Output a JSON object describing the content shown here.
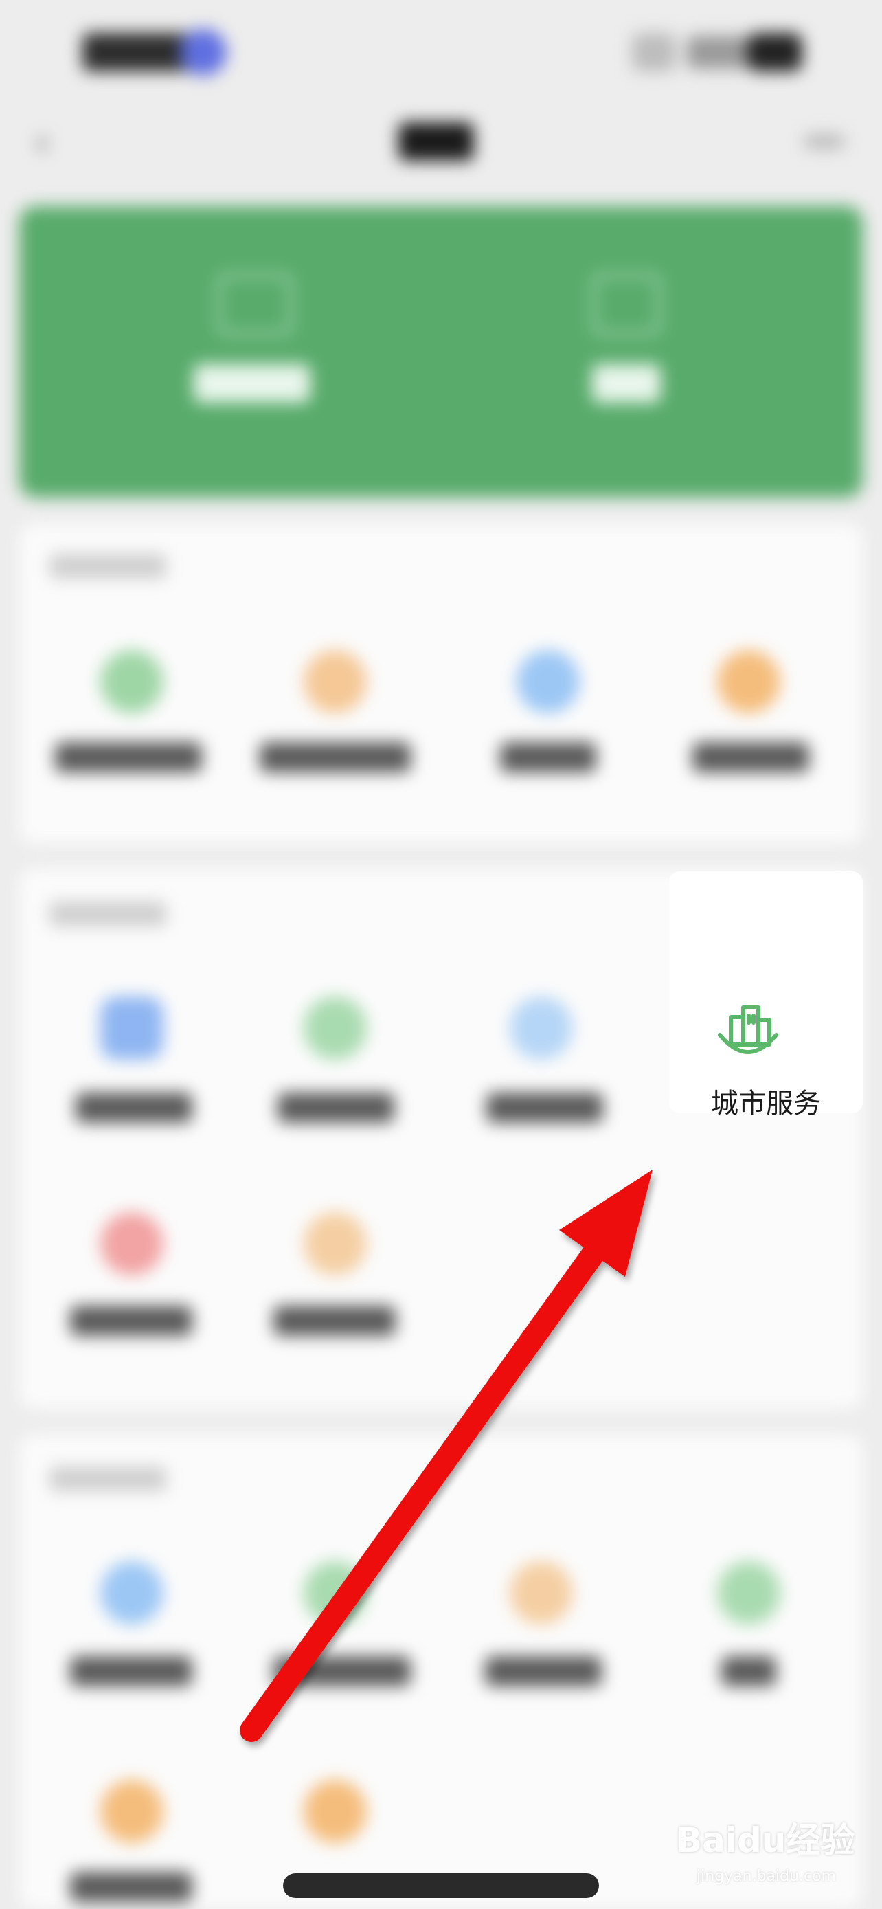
{
  "city_service": {
    "label": "城市服务",
    "icon": "city-buildings-icon",
    "accent": "#5bb86a"
  },
  "colors": {
    "banner": "#58ab6b",
    "arrow": "#ee1111",
    "background": "#ededed"
  },
  "watermark": {
    "text": "Baidu经验",
    "sub": "jingyan.baidu.com"
  }
}
